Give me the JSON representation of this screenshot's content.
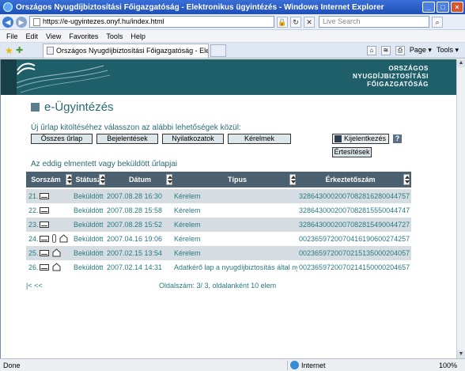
{
  "window": {
    "title": "Országos Nyugdíjbiztosítási Főigazgatóság - Elektronikus ügyintézés - Windows Internet Explorer",
    "url": "https://e-ugyintezes.onyf.hu/index.html",
    "search_placeholder": "Live Search"
  },
  "menu": [
    "File",
    "Edit",
    "View",
    "Favorites",
    "Tools",
    "Help"
  ],
  "tab": {
    "label": "Országos Nyugdíjbiztosítási Főigazgatóság - Elektroni..."
  },
  "toolbar": {
    "page_label": "Page",
    "tools_label": "Tools"
  },
  "site": {
    "logo_lines": [
      "ORSZÁGOS",
      "NYUGDÍJBIZTOSÍTÁSI",
      "FŐIGAZGATÓSÁG"
    ],
    "headline": "e-Ügyintézés",
    "prompt": "Új űrlap kitöltéséhez válasszon az alábbi lehetőségek közül:",
    "buttons": [
      "Összes űrlap",
      "Bejelentések",
      "Nyilatkozatok",
      "Kérelmek"
    ],
    "logout_label": "Kijelentkezés",
    "notifications_label": "Értesítések",
    "help_label": "?",
    "saved_title": "Az eddig elmentett vagy beküldött űrlapjai"
  },
  "grid": {
    "headers": [
      "Sorszám",
      "Státusz",
      "Dátum",
      "Típus",
      "Érkeztetőszám"
    ],
    "rows": [
      {
        "num": "21.",
        "status": "Beküldött",
        "date": "2007.08.28 16:30",
        "type": "Kérelem",
        "reg": "3286430002007082816280044757",
        "icons": [
          "envelope"
        ]
      },
      {
        "num": "22.",
        "status": "Beküldött",
        "date": "2007.08.28 15:58",
        "type": "Kérelem",
        "reg": "3286430002007082815550044747",
        "icons": [
          "envelope"
        ]
      },
      {
        "num": "23.",
        "status": "Beküldött",
        "date": "2007.08.28 15:52",
        "type": "Kérelem",
        "reg": "3286430002007082815490044727",
        "icons": [
          "envelope"
        ]
      },
      {
        "num": "24.",
        "status": "Beküldött",
        "date": "2007.04.16 19:06",
        "type": "Kérelem",
        "reg": "0023659720070416190600274257",
        "icons": [
          "envelope",
          "paperclip",
          "house"
        ]
      },
      {
        "num": "25.",
        "status": "Beküldött",
        "date": "2007.02.15 13:54",
        "type": "Kérelem",
        "reg": "0023659720070215135000204057",
        "icons": [
          "envelope",
          "house"
        ]
      },
      {
        "num": "26.",
        "status": "Beküldött",
        "date": "2007.02.14 14:31",
        "type": "Adatkérő lap a nyugdíjbiztosítás által nyilvántartott",
        "reg": "0023659720070214150000204657",
        "icons": [
          "envelope",
          "house"
        ]
      }
    ]
  },
  "pager": {
    "nav": "|<  <<",
    "info": "Oldalszám: 3/ 3, oldalanként 10 elem"
  },
  "status": {
    "left": "Done",
    "zone": "Internet",
    "zoom": "100%"
  },
  "colors": {
    "accent": "#2a7a84",
    "header": "#4b6070",
    "row_alt": "#d5dde2"
  }
}
